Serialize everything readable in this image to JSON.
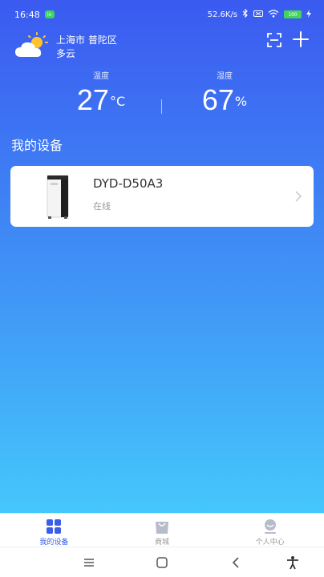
{
  "status_bar": {
    "time": "16:48",
    "net_speed": "52.6K/s",
    "battery": "100",
    "app_badge": "in"
  },
  "header": {
    "location": "上海市 普陀区",
    "weather": "多云",
    "icons": {
      "weather": "partly-cloudy-icon",
      "scan": "scan-icon",
      "add": "plus-icon"
    }
  },
  "readings": {
    "temperature": {
      "label": "温度",
      "value": "27",
      "unit": "°C"
    },
    "humidity": {
      "label": "湿度",
      "value": "67",
      "unit": "%"
    }
  },
  "section_title": "我的设备",
  "devices": [
    {
      "name": "DYD-D50A3",
      "status": "在线"
    }
  ],
  "tabs": [
    {
      "label": "我的设备",
      "icon": "grid-icon",
      "active": true
    },
    {
      "label": "商城",
      "icon": "shopping-bag-icon",
      "active": false
    },
    {
      "label": "个人中心",
      "icon": "user-icon",
      "active": false
    }
  ],
  "colors": {
    "gradient_top": "#3b5af0",
    "gradient_bottom": "#44c7fb",
    "accent": "#3a5ee8",
    "card_bg": "#ffffff"
  }
}
